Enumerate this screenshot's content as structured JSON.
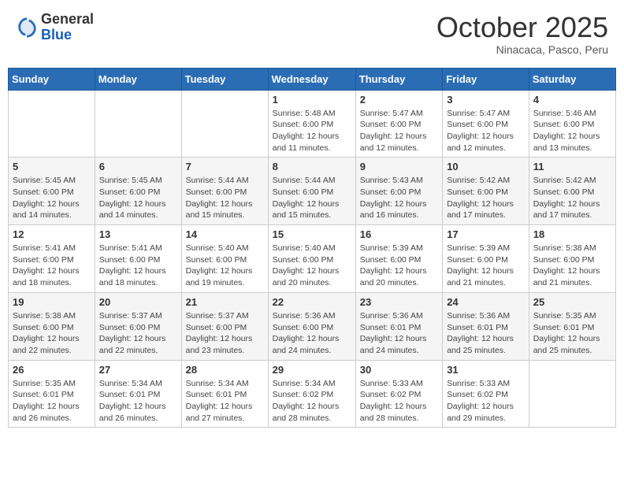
{
  "header": {
    "logo_general": "General",
    "logo_blue": "Blue",
    "month": "October 2025",
    "location": "Ninacaca, Pasco, Peru"
  },
  "weekdays": [
    "Sunday",
    "Monday",
    "Tuesday",
    "Wednesday",
    "Thursday",
    "Friday",
    "Saturday"
  ],
  "weeks": [
    [
      {
        "day": "",
        "info": ""
      },
      {
        "day": "",
        "info": ""
      },
      {
        "day": "",
        "info": ""
      },
      {
        "day": "1",
        "info": "Sunrise: 5:48 AM\nSunset: 6:00 PM\nDaylight: 12 hours\nand 11 minutes."
      },
      {
        "day": "2",
        "info": "Sunrise: 5:47 AM\nSunset: 6:00 PM\nDaylight: 12 hours\nand 12 minutes."
      },
      {
        "day": "3",
        "info": "Sunrise: 5:47 AM\nSunset: 6:00 PM\nDaylight: 12 hours\nand 12 minutes."
      },
      {
        "day": "4",
        "info": "Sunrise: 5:46 AM\nSunset: 6:00 PM\nDaylight: 12 hours\nand 13 minutes."
      }
    ],
    [
      {
        "day": "5",
        "info": "Sunrise: 5:45 AM\nSunset: 6:00 PM\nDaylight: 12 hours\nand 14 minutes."
      },
      {
        "day": "6",
        "info": "Sunrise: 5:45 AM\nSunset: 6:00 PM\nDaylight: 12 hours\nand 14 minutes."
      },
      {
        "day": "7",
        "info": "Sunrise: 5:44 AM\nSunset: 6:00 PM\nDaylight: 12 hours\nand 15 minutes."
      },
      {
        "day": "8",
        "info": "Sunrise: 5:44 AM\nSunset: 6:00 PM\nDaylight: 12 hours\nand 15 minutes."
      },
      {
        "day": "9",
        "info": "Sunrise: 5:43 AM\nSunset: 6:00 PM\nDaylight: 12 hours\nand 16 minutes."
      },
      {
        "day": "10",
        "info": "Sunrise: 5:42 AM\nSunset: 6:00 PM\nDaylight: 12 hours\nand 17 minutes."
      },
      {
        "day": "11",
        "info": "Sunrise: 5:42 AM\nSunset: 6:00 PM\nDaylight: 12 hours\nand 17 minutes."
      }
    ],
    [
      {
        "day": "12",
        "info": "Sunrise: 5:41 AM\nSunset: 6:00 PM\nDaylight: 12 hours\nand 18 minutes."
      },
      {
        "day": "13",
        "info": "Sunrise: 5:41 AM\nSunset: 6:00 PM\nDaylight: 12 hours\nand 18 minutes."
      },
      {
        "day": "14",
        "info": "Sunrise: 5:40 AM\nSunset: 6:00 PM\nDaylight: 12 hours\nand 19 minutes."
      },
      {
        "day": "15",
        "info": "Sunrise: 5:40 AM\nSunset: 6:00 PM\nDaylight: 12 hours\nand 20 minutes."
      },
      {
        "day": "16",
        "info": "Sunrise: 5:39 AM\nSunset: 6:00 PM\nDaylight: 12 hours\nand 20 minutes."
      },
      {
        "day": "17",
        "info": "Sunrise: 5:39 AM\nSunset: 6:00 PM\nDaylight: 12 hours\nand 21 minutes."
      },
      {
        "day": "18",
        "info": "Sunrise: 5:38 AM\nSunset: 6:00 PM\nDaylight: 12 hours\nand 21 minutes."
      }
    ],
    [
      {
        "day": "19",
        "info": "Sunrise: 5:38 AM\nSunset: 6:00 PM\nDaylight: 12 hours\nand 22 minutes."
      },
      {
        "day": "20",
        "info": "Sunrise: 5:37 AM\nSunset: 6:00 PM\nDaylight: 12 hours\nand 22 minutes."
      },
      {
        "day": "21",
        "info": "Sunrise: 5:37 AM\nSunset: 6:00 PM\nDaylight: 12 hours\nand 23 minutes."
      },
      {
        "day": "22",
        "info": "Sunrise: 5:36 AM\nSunset: 6:00 PM\nDaylight: 12 hours\nand 24 minutes."
      },
      {
        "day": "23",
        "info": "Sunrise: 5:36 AM\nSunset: 6:01 PM\nDaylight: 12 hours\nand 24 minutes."
      },
      {
        "day": "24",
        "info": "Sunrise: 5:36 AM\nSunset: 6:01 PM\nDaylight: 12 hours\nand 25 minutes."
      },
      {
        "day": "25",
        "info": "Sunrise: 5:35 AM\nSunset: 6:01 PM\nDaylight: 12 hours\nand 25 minutes."
      }
    ],
    [
      {
        "day": "26",
        "info": "Sunrise: 5:35 AM\nSunset: 6:01 PM\nDaylight: 12 hours\nand 26 minutes."
      },
      {
        "day": "27",
        "info": "Sunrise: 5:34 AM\nSunset: 6:01 PM\nDaylight: 12 hours\nand 26 minutes."
      },
      {
        "day": "28",
        "info": "Sunrise: 5:34 AM\nSunset: 6:01 PM\nDaylight: 12 hours\nand 27 minutes."
      },
      {
        "day": "29",
        "info": "Sunrise: 5:34 AM\nSunset: 6:02 PM\nDaylight: 12 hours\nand 28 minutes."
      },
      {
        "day": "30",
        "info": "Sunrise: 5:33 AM\nSunset: 6:02 PM\nDaylight: 12 hours\nand 28 minutes."
      },
      {
        "day": "31",
        "info": "Sunrise: 5:33 AM\nSunset: 6:02 PM\nDaylight: 12 hours\nand 29 minutes."
      },
      {
        "day": "",
        "info": ""
      }
    ]
  ]
}
